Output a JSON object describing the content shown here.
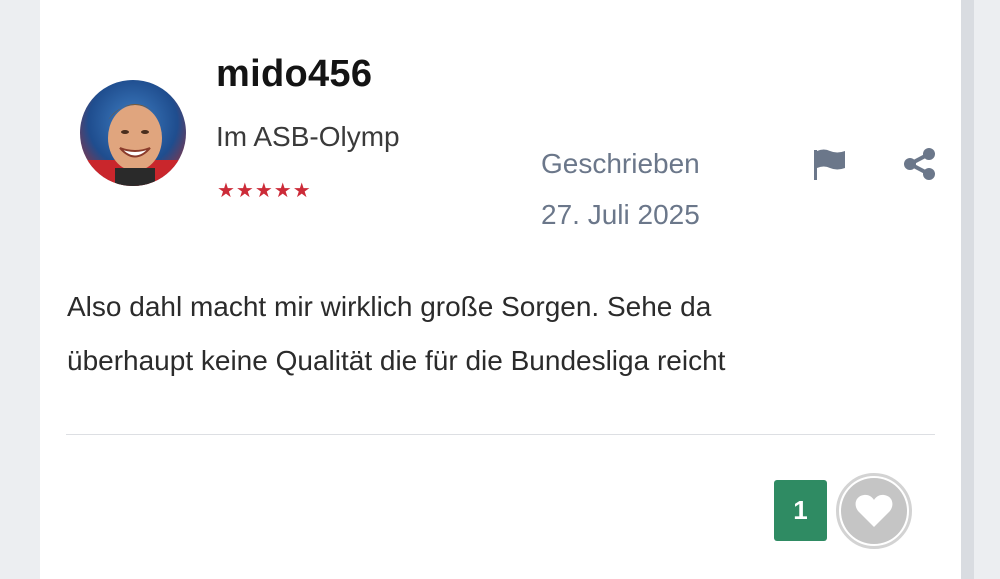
{
  "post": {
    "author": {
      "username": "mido456",
      "rank": "Im ASB-Olymp",
      "stars": "★★★★★"
    },
    "meta": {
      "label": "Geschrieben",
      "date": "27. Juli 2025"
    },
    "body_lines": [
      "Also dahl macht mir wirklich große Sorgen. Sehe da",
      "überhaupt keine Qualität die für die Bundesliga reicht"
    ],
    "reactions": {
      "count": "1",
      "icon": "heart-icon"
    }
  },
  "icons": {
    "report": "flag-icon",
    "share": "share-icon"
  },
  "colors": {
    "reaction_badge": "#2f8b63",
    "stars": "#cc2b38",
    "meta_text": "#6b778a"
  }
}
